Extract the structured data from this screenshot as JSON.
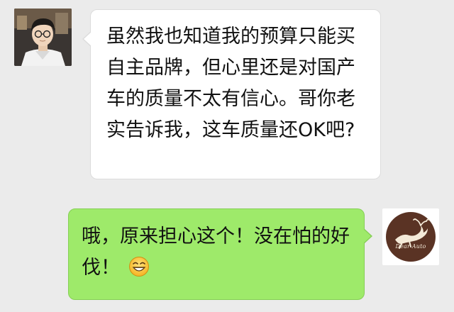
{
  "chat": {
    "incoming": {
      "sender": "friend",
      "text": "虽然我也知道我的预算只能买自主品牌，但心里还是对国产车的质量不太有信心。哥你老实告诉我，这车质量还OK吧?",
      "bubble_color": "#ffffff"
    },
    "outgoing": {
      "sender": "Dear Auto",
      "text": "哦，原来担心这个！没在怕的好伐！",
      "emoji": "grinning-face-icon",
      "bubble_color": "#9eea6a",
      "avatar_logo_text": "Dear Auto",
      "avatar_logo_color": "#5a3324"
    }
  },
  "colors": {
    "background": "#ebebeb",
    "incoming_bubble": "#ffffff",
    "outgoing_bubble": "#9eea6a"
  }
}
